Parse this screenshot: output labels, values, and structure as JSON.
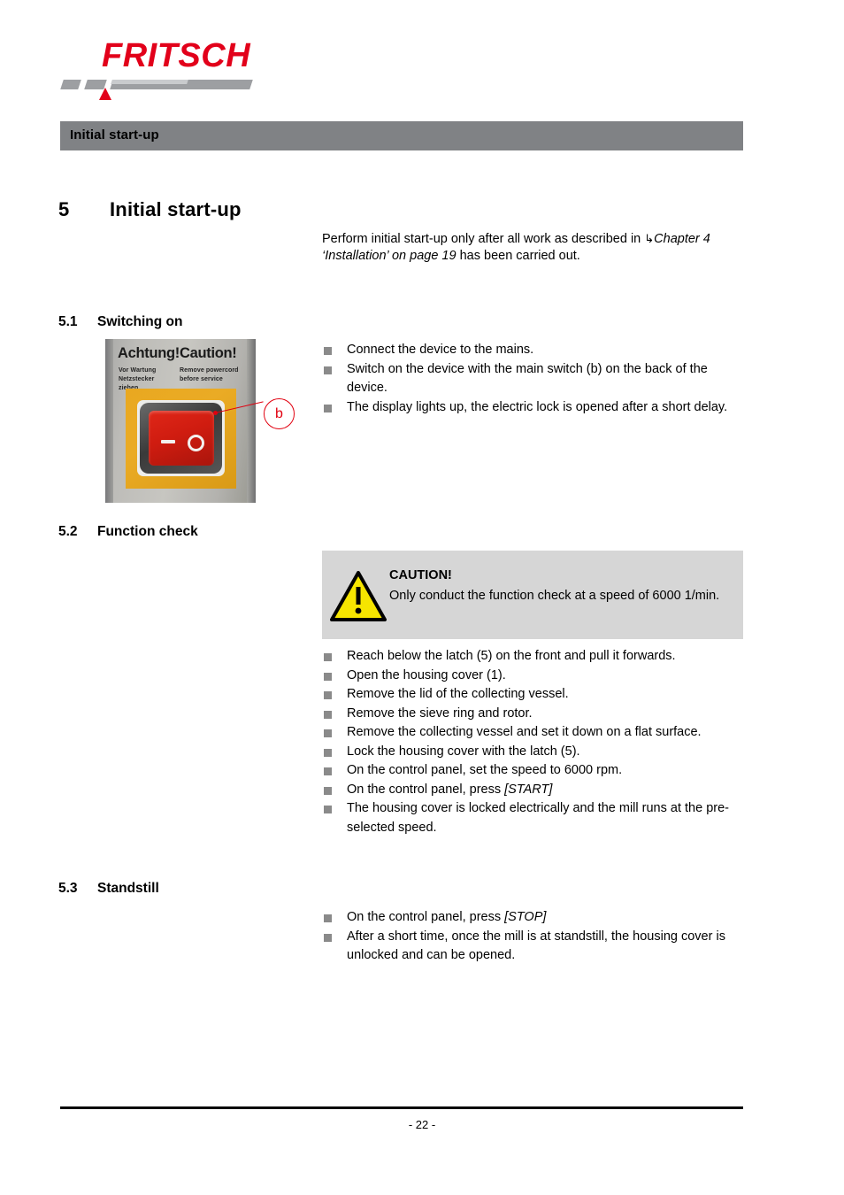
{
  "brand": {
    "logo_text": "FRITSCH"
  },
  "running_header": {
    "title": "Initial start-up"
  },
  "chapter": {
    "number": "5",
    "title": "Initial start-up",
    "intro_prefix": "Perform initial start-up only after all work as described in ",
    "intro_ref_icon": "↳",
    "intro_ref": "Chapter 4 ‘Installation’ on page 19",
    "intro_suffix": " has been carried out."
  },
  "sections": [
    {
      "number": "5.1",
      "title": "Switching on",
      "items": [
        "Connect the device to the mains.",
        "Switch on the device with the main switch (b) on the back of the device.",
        "The display lights up, the electric lock is opened after a short delay."
      ]
    },
    {
      "number": "5.2",
      "title": "Function check",
      "items": [
        "Reach below the latch (5) on the front and pull it forwards.",
        "Open the housing cover (1).",
        "Remove the lid of the collecting vessel.",
        "Remove the sieve ring and rotor.",
        "Remove the collecting vessel and set it down on a flat surface.",
        "Lock the housing cover with the latch (5).",
        "On the control panel, set the speed to 6000 rpm."
      ],
      "item_start_prefix": "On the control panel, press ",
      "item_start_key": "[START]",
      "item_last": "The housing cover is locked electrically and the mill runs at the pre-selected speed."
    },
    {
      "number": "5.3",
      "title": "Standstill",
      "item_stop_prefix": "On the control panel, press ",
      "item_stop_key": "[STOP]",
      "item_last": "After a short time, once the mill is at standstill, the housing cover is unlocked and can be opened."
    }
  ],
  "caution": {
    "heading": "CAUTION!",
    "text": "Only conduct the function check at a speed of 6000 1/min.",
    "triangle_color": "#f6e500",
    "box_color": "#d6d6d6"
  },
  "figure": {
    "caption_de": "Achtung!",
    "caption_en": "Caution!",
    "sub_de": "Vor Wartung Netzstecker ziehen",
    "sub_en": "Remove powercord before service",
    "switch_off_mark": "—",
    "switch_on_mark": "O",
    "callout_label": "b",
    "callout_color": "#e1000f"
  },
  "footer": {
    "page_label": "- 22 -"
  },
  "colors": {
    "brand_red": "#e2001a",
    "header_gray": "#808285",
    "bullet_gray": "#8a8a8a"
  }
}
